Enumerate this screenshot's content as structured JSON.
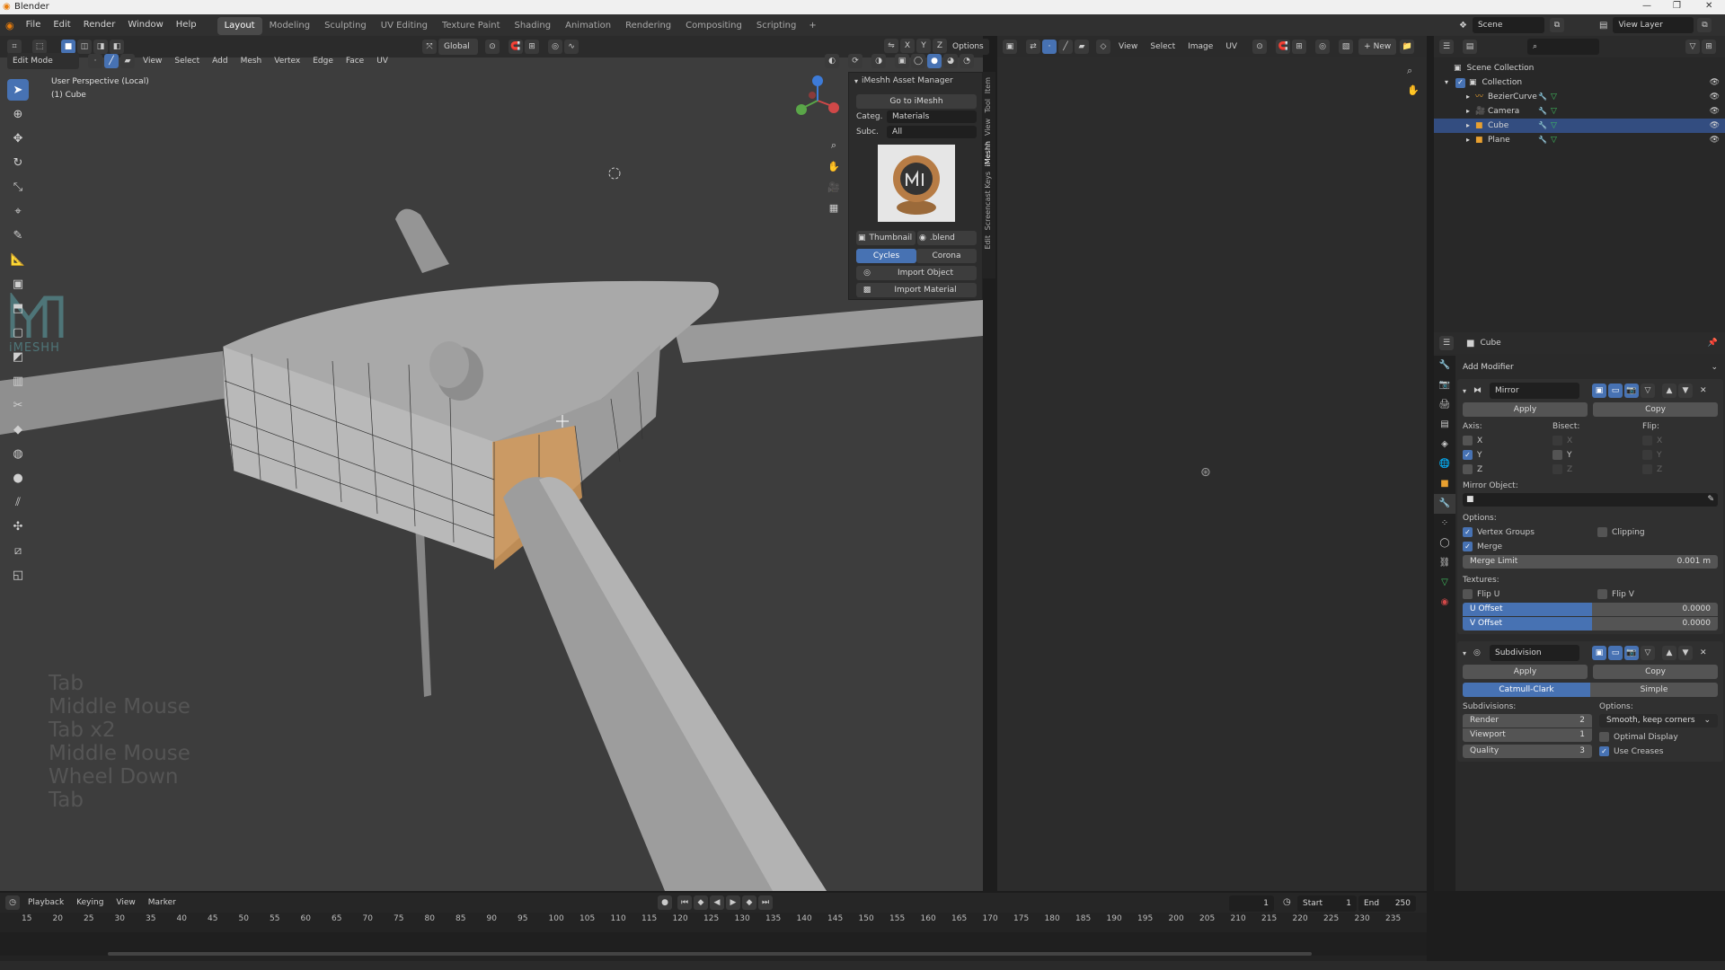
{
  "app": {
    "title": "Blender"
  },
  "menu": {
    "items": [
      "File",
      "Edit",
      "Render",
      "Window",
      "Help"
    ],
    "workspaces": [
      "Layout",
      "Modeling",
      "Sculpting",
      "UV Editing",
      "Texture Paint",
      "Shading",
      "Animation",
      "Rendering",
      "Compositing",
      "Scripting"
    ],
    "active_workspace": "Layout",
    "scene": "Scene",
    "view_layer": "View Layer"
  },
  "viewport_header": {
    "mode": "Edit Mode",
    "menus": [
      "View",
      "Select",
      "Add",
      "Mesh",
      "Vertex",
      "Edge",
      "Face",
      "UV"
    ],
    "transform": "Global",
    "axes": [
      "X",
      "Y",
      "Z"
    ],
    "options": "Options"
  },
  "viewport": {
    "perspective": "User Perspective (Local)",
    "object": "(1) Cube",
    "key_log": [
      "Tab",
      "Middle Mouse",
      "Tab x2",
      "Middle Mouse",
      "Wheel Down",
      "Tab"
    ],
    "logo_text": "iMESHH"
  },
  "asset_manager": {
    "title": "iMeshh Asset Manager",
    "go_button": "Go to iMeshh",
    "category_label": "Categ.",
    "category_value": "Materials",
    "subcategory_label": "Subc.",
    "subcategory_value": "All",
    "thumbnail_button": "Thumbnail",
    "blend_button": ".blend",
    "engine_cycles": "Cycles",
    "engine_corona": "Corona",
    "import_object": "Import Object",
    "import_material": "Import Material",
    "tabs": [
      "Item",
      "Tool",
      "View",
      "iMeshh",
      "Screencast Keys",
      "Edit"
    ]
  },
  "image_editor_header": {
    "menus": [
      "View",
      "Select",
      "Image",
      "UV"
    ],
    "new_button": "New"
  },
  "outliner": {
    "root": "Scene Collection",
    "collection": "Collection",
    "items": [
      {
        "name": "BezierCurve",
        "selected": false
      },
      {
        "name": "Camera",
        "selected": false
      },
      {
        "name": "Cube",
        "selected": true
      },
      {
        "name": "Plane",
        "selected": false
      }
    ]
  },
  "properties": {
    "object_name": "Cube",
    "add_modifier": "Add Modifier",
    "mirror": {
      "name": "Mirror",
      "apply": "Apply",
      "copy": "Copy",
      "axis_label": "Axis:",
      "bisect_label": "Bisect:",
      "flip_label": "Flip:",
      "axes": [
        "X",
        "Y",
        "Z"
      ],
      "mirror_object_label": "Mirror Object:",
      "options_label": "Options:",
      "vertex_groups": "Vertex Groups",
      "clipping": "Clipping",
      "merge": "Merge",
      "merge_limit_label": "Merge Limit",
      "merge_limit_value": "0.001 m",
      "textures_label": "Textures:",
      "flip_u": "Flip U",
      "flip_v": "Flip V",
      "u_offset_label": "U Offset",
      "u_offset_value": "0.0000",
      "v_offset_label": "V Offset",
      "v_offset_value": "0.0000"
    },
    "subdivision": {
      "name": "Subdivision",
      "apply": "Apply",
      "copy": "Copy",
      "catmull": "Catmull-Clark",
      "simple": "Simple",
      "subdivisions_label": "Subdivisions:",
      "options_label": "Options:",
      "render_label": "Render",
      "render_value": "2",
      "viewport_label": "Viewport",
      "viewport_value": "1",
      "quality_label": "Quality",
      "quality_value": "3",
      "uv_smooth": "Smooth, keep corners",
      "optimal_display": "Optimal Display",
      "use_creases": "Use Creases"
    }
  },
  "timeline": {
    "menus": [
      "Playback",
      "Keying",
      "View",
      "Marker"
    ],
    "current_frame": "1",
    "start_label": "Start",
    "start_value": "1",
    "end_label": "End",
    "end_value": "250",
    "ticks": [
      "15",
      "20",
      "25",
      "30",
      "35",
      "40",
      "45",
      "50",
      "55",
      "60",
      "65",
      "70",
      "75",
      "80",
      "85",
      "90",
      "95",
      "100",
      "105",
      "110",
      "115",
      "120",
      "125",
      "130",
      "135",
      "140",
      "145",
      "150",
      "155",
      "160",
      "165",
      "170",
      "175",
      "180",
      "185",
      "190",
      "195",
      "200",
      "205",
      "210",
      "215",
      "220",
      "225",
      "230",
      "235"
    ]
  },
  "colors": {
    "accent": "#4772b3",
    "selected_face": "#d39a5a"
  }
}
